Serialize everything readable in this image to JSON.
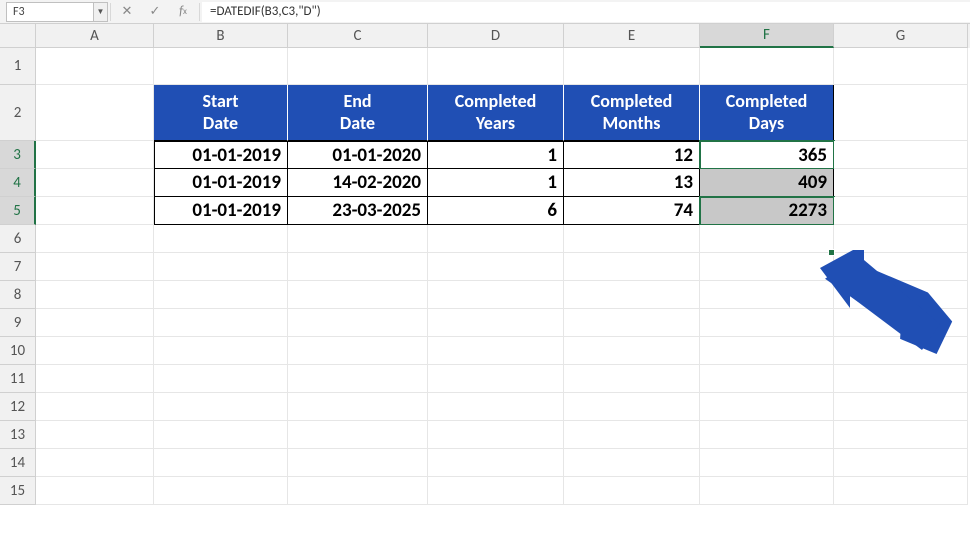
{
  "name_box": "F3",
  "formula": "=DATEDIF(B3,C3,\"D\")",
  "columns": [
    "A",
    "B",
    "C",
    "D",
    "E",
    "F",
    "G"
  ],
  "selected_column": "F",
  "rows_displayed": [
    1,
    2,
    3,
    4,
    5,
    6,
    7,
    8,
    9,
    10,
    11,
    12,
    13,
    14,
    15
  ],
  "selected_rows": [
    3,
    4,
    5
  ],
  "headers": {
    "B": "Start Date",
    "C": "End Date",
    "D": "Completed Years",
    "E": "Completed Months",
    "F": "Completed Days"
  },
  "chart_data": {
    "type": "table",
    "columns": [
      "Start Date",
      "End Date",
      "Completed Years",
      "Completed Months",
      "Completed Days"
    ],
    "rows": [
      {
        "start": "01-01-2019",
        "end": "01-01-2020",
        "years": "1",
        "months": "12",
        "days": "365"
      },
      {
        "start": "01-01-2019",
        "end": "14-02-2020",
        "years": "1",
        "months": "13",
        "days": "409"
      },
      {
        "start": "01-01-2019",
        "end": "23-03-2025",
        "years": "6",
        "months": "74",
        "days": "2273"
      }
    ]
  },
  "row_nums": {
    "r1": "1",
    "r2": "2",
    "r3": "3",
    "r4": "4",
    "r5": "5",
    "r6": "6",
    "r7": "7",
    "r8": "8",
    "r9": "9",
    "r10": "10",
    "r11": "11",
    "r12": "12",
    "r13": "13",
    "r14": "14",
    "r15": "15"
  }
}
